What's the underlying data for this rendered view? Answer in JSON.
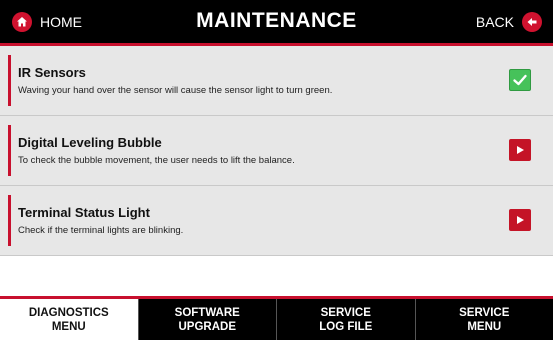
{
  "header": {
    "home_label": "HOME",
    "title": "MAINTENANCE",
    "back_label": "BACK"
  },
  "items": [
    {
      "title": "IR Sensors",
      "description": "Waving your hand over the sensor will cause the sensor light to turn green.",
      "status_icon": "check-icon"
    },
    {
      "title": "Digital Leveling Bubble",
      "description": "To check the bubble movement, the user needs to lift the balance.",
      "status_icon": "play-icon"
    },
    {
      "title": "Terminal Status Light",
      "description": "Check if the terminal lights are blinking.",
      "status_icon": "play-icon"
    }
  ],
  "tabs": [
    {
      "label": "DIAGNOSTICS\nMENU",
      "active": true
    },
    {
      "label": "SOFTWARE\nUPGRADE",
      "active": false
    },
    {
      "label": "SERVICE\nLOG FILE",
      "active": false
    },
    {
      "label": "SERVICE\nMENU",
      "active": false
    }
  ],
  "colors": {
    "accent": "#c8102e",
    "success": "#46c25a",
    "header_bg": "#000000",
    "list_bg": "#e7e7e7"
  }
}
